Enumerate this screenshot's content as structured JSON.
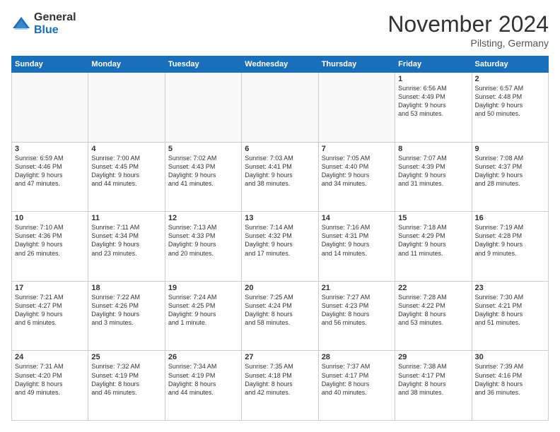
{
  "logo": {
    "general": "General",
    "blue": "Blue"
  },
  "header": {
    "month": "November 2024",
    "location": "Pilsting, Germany"
  },
  "weekdays": [
    "Sunday",
    "Monday",
    "Tuesday",
    "Wednesday",
    "Thursday",
    "Friday",
    "Saturday"
  ],
  "weeks": [
    [
      {
        "day": "",
        "info": ""
      },
      {
        "day": "",
        "info": ""
      },
      {
        "day": "",
        "info": ""
      },
      {
        "day": "",
        "info": ""
      },
      {
        "day": "",
        "info": ""
      },
      {
        "day": "1",
        "info": "Sunrise: 6:56 AM\nSunset: 4:49 PM\nDaylight: 9 hours\nand 53 minutes."
      },
      {
        "day": "2",
        "info": "Sunrise: 6:57 AM\nSunset: 4:48 PM\nDaylight: 9 hours\nand 50 minutes."
      }
    ],
    [
      {
        "day": "3",
        "info": "Sunrise: 6:59 AM\nSunset: 4:46 PM\nDaylight: 9 hours\nand 47 minutes."
      },
      {
        "day": "4",
        "info": "Sunrise: 7:00 AM\nSunset: 4:45 PM\nDaylight: 9 hours\nand 44 minutes."
      },
      {
        "day": "5",
        "info": "Sunrise: 7:02 AM\nSunset: 4:43 PM\nDaylight: 9 hours\nand 41 minutes."
      },
      {
        "day": "6",
        "info": "Sunrise: 7:03 AM\nSunset: 4:41 PM\nDaylight: 9 hours\nand 38 minutes."
      },
      {
        "day": "7",
        "info": "Sunrise: 7:05 AM\nSunset: 4:40 PM\nDaylight: 9 hours\nand 34 minutes."
      },
      {
        "day": "8",
        "info": "Sunrise: 7:07 AM\nSunset: 4:39 PM\nDaylight: 9 hours\nand 31 minutes."
      },
      {
        "day": "9",
        "info": "Sunrise: 7:08 AM\nSunset: 4:37 PM\nDaylight: 9 hours\nand 28 minutes."
      }
    ],
    [
      {
        "day": "10",
        "info": "Sunrise: 7:10 AM\nSunset: 4:36 PM\nDaylight: 9 hours\nand 26 minutes."
      },
      {
        "day": "11",
        "info": "Sunrise: 7:11 AM\nSunset: 4:34 PM\nDaylight: 9 hours\nand 23 minutes."
      },
      {
        "day": "12",
        "info": "Sunrise: 7:13 AM\nSunset: 4:33 PM\nDaylight: 9 hours\nand 20 minutes."
      },
      {
        "day": "13",
        "info": "Sunrise: 7:14 AM\nSunset: 4:32 PM\nDaylight: 9 hours\nand 17 minutes."
      },
      {
        "day": "14",
        "info": "Sunrise: 7:16 AM\nSunset: 4:31 PM\nDaylight: 9 hours\nand 14 minutes."
      },
      {
        "day": "15",
        "info": "Sunrise: 7:18 AM\nSunset: 4:29 PM\nDaylight: 9 hours\nand 11 minutes."
      },
      {
        "day": "16",
        "info": "Sunrise: 7:19 AM\nSunset: 4:28 PM\nDaylight: 9 hours\nand 9 minutes."
      }
    ],
    [
      {
        "day": "17",
        "info": "Sunrise: 7:21 AM\nSunset: 4:27 PM\nDaylight: 9 hours\nand 6 minutes."
      },
      {
        "day": "18",
        "info": "Sunrise: 7:22 AM\nSunset: 4:26 PM\nDaylight: 9 hours\nand 3 minutes."
      },
      {
        "day": "19",
        "info": "Sunrise: 7:24 AM\nSunset: 4:25 PM\nDaylight: 9 hours\nand 1 minute."
      },
      {
        "day": "20",
        "info": "Sunrise: 7:25 AM\nSunset: 4:24 PM\nDaylight: 8 hours\nand 58 minutes."
      },
      {
        "day": "21",
        "info": "Sunrise: 7:27 AM\nSunset: 4:23 PM\nDaylight: 8 hours\nand 56 minutes."
      },
      {
        "day": "22",
        "info": "Sunrise: 7:28 AM\nSunset: 4:22 PM\nDaylight: 8 hours\nand 53 minutes."
      },
      {
        "day": "23",
        "info": "Sunrise: 7:30 AM\nSunset: 4:21 PM\nDaylight: 8 hours\nand 51 minutes."
      }
    ],
    [
      {
        "day": "24",
        "info": "Sunrise: 7:31 AM\nSunset: 4:20 PM\nDaylight: 8 hours\nand 49 minutes."
      },
      {
        "day": "25",
        "info": "Sunrise: 7:32 AM\nSunset: 4:19 PM\nDaylight: 8 hours\nand 46 minutes."
      },
      {
        "day": "26",
        "info": "Sunrise: 7:34 AM\nSunset: 4:19 PM\nDaylight: 8 hours\nand 44 minutes."
      },
      {
        "day": "27",
        "info": "Sunrise: 7:35 AM\nSunset: 4:18 PM\nDaylight: 8 hours\nand 42 minutes."
      },
      {
        "day": "28",
        "info": "Sunrise: 7:37 AM\nSunset: 4:17 PM\nDaylight: 8 hours\nand 40 minutes."
      },
      {
        "day": "29",
        "info": "Sunrise: 7:38 AM\nSunset: 4:17 PM\nDaylight: 8 hours\nand 38 minutes."
      },
      {
        "day": "30",
        "info": "Sunrise: 7:39 AM\nSunset: 4:16 PM\nDaylight: 8 hours\nand 36 minutes."
      }
    ]
  ]
}
